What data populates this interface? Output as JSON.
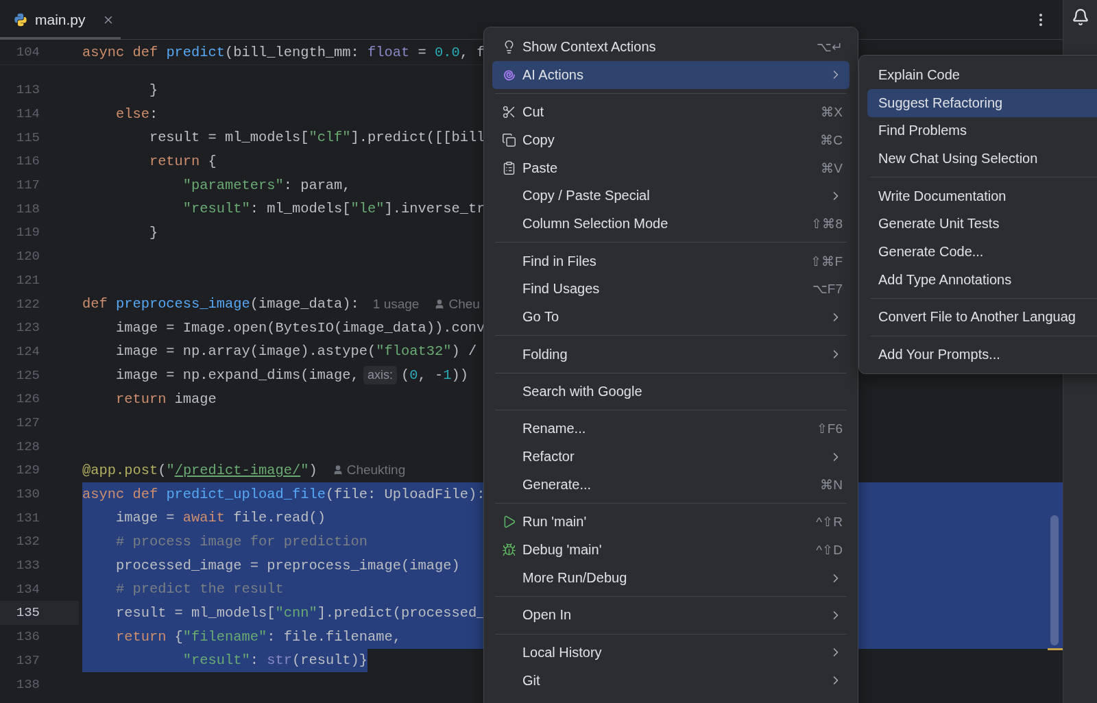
{
  "tab": {
    "label": "main.py",
    "selected": true
  },
  "sticky_line": {
    "number": "104",
    "tokens": [
      {
        "kind": "kw",
        "text": "async def "
      },
      {
        "kind": "fn",
        "text": "predict"
      },
      {
        "kind": "p",
        "text": "(bill_length_mm: "
      },
      {
        "kind": "bi",
        "text": "float"
      },
      {
        "kind": "p",
        "text": " = "
      },
      {
        "kind": "num",
        "text": "0.0"
      },
      {
        "kind": "p",
        "text": ", f"
      }
    ]
  },
  "lines": [
    {
      "number": "113",
      "current": false,
      "selected": false,
      "tokens": [
        {
          "kind": "p",
          "text": "        }"
        }
      ]
    },
    {
      "number": "114",
      "current": false,
      "selected": false,
      "tokens": [
        {
          "kind": "kw",
          "text": "    else"
        },
        {
          "kind": "p",
          "text": ":"
        }
      ]
    },
    {
      "number": "115",
      "current": false,
      "selected": false,
      "tokens": [
        {
          "kind": "p",
          "text": "        result = ml_models["
        },
        {
          "kind": "str",
          "text": "\"clf\""
        },
        {
          "kind": "p",
          "text": "].predict([[bill"
        }
      ]
    },
    {
      "number": "116",
      "current": false,
      "selected": false,
      "tokens": [
        {
          "kind": "kw",
          "text": "        return"
        },
        {
          "kind": "p",
          "text": " {"
        }
      ]
    },
    {
      "number": "117",
      "current": false,
      "selected": false,
      "tokens": [
        {
          "kind": "str",
          "text": "            \"parameters\""
        },
        {
          "kind": "p",
          "text": ": param,"
        }
      ]
    },
    {
      "number": "118",
      "current": false,
      "selected": false,
      "tokens": [
        {
          "kind": "str",
          "text": "            \"result\""
        },
        {
          "kind": "p",
          "text": ": ml_models["
        },
        {
          "kind": "str",
          "text": "\"le\""
        },
        {
          "kind": "p",
          "text": "].inverse_tr"
        }
      ]
    },
    {
      "number": "119",
      "current": false,
      "selected": false,
      "tokens": [
        {
          "kind": "p",
          "text": "        }"
        }
      ]
    },
    {
      "number": "120",
      "current": false,
      "selected": false
    },
    {
      "number": "121",
      "current": false,
      "selected": false
    },
    {
      "number": "122",
      "current": false,
      "selected": false,
      "tokens": [
        {
          "kind": "kw",
          "text": "def "
        },
        {
          "kind": "fn",
          "text": "preprocess_image"
        },
        {
          "kind": "p",
          "text": "(image_data):"
        }
      ],
      "usage_hint": "1 usage",
      "author": "Cheu"
    },
    {
      "number": "123",
      "current": false,
      "selected": false,
      "tokens": [
        {
          "kind": "p",
          "text": "    image = Image.open(BytesIO(image_data)).conv"
        }
      ]
    },
    {
      "number": "124",
      "current": false,
      "selected": false,
      "tokens": [
        {
          "kind": "p",
          "text": "    image = np.array(image).astype("
        },
        {
          "kind": "str",
          "text": "\"float32\""
        },
        {
          "kind": "p",
          "text": ") /"
        }
      ]
    },
    {
      "number": "125",
      "current": false,
      "selected": false,
      "tokens": [
        {
          "kind": "p",
          "text": "    image = np.expand_dims(image, "
        }
      ],
      "inlay": "axis:",
      "tokens_after": [
        {
          "kind": "p",
          "text": "("
        },
        {
          "kind": "num",
          "text": "0"
        },
        {
          "kind": "p",
          "text": ", -"
        },
        {
          "kind": "num",
          "text": "1"
        },
        {
          "kind": "p",
          "text": "))"
        }
      ]
    },
    {
      "number": "126",
      "current": false,
      "selected": false,
      "tokens": [
        {
          "kind": "kw",
          "text": "    return"
        },
        {
          "kind": "p",
          "text": " image"
        }
      ]
    },
    {
      "number": "127",
      "current": false,
      "selected": false
    },
    {
      "number": "128",
      "current": false,
      "selected": false
    },
    {
      "number": "129",
      "current": false,
      "selected": false,
      "tokens": [
        {
          "kind": "deco",
          "text": "@app.post"
        },
        {
          "kind": "p",
          "text": "("
        },
        {
          "kind": "str",
          "text": "\""
        },
        {
          "kind": "link",
          "text": "/predict-image/"
        },
        {
          "kind": "str",
          "text": "\""
        },
        {
          "kind": "p",
          "text": ")"
        }
      ],
      "author": "Cheukting"
    },
    {
      "number": "130",
      "current": false,
      "selected": true,
      "tokens": [
        {
          "kind": "kw",
          "text": "async def "
        },
        {
          "kind": "fn",
          "text": "predict_upload_file"
        },
        {
          "kind": "p",
          "text": "(file: UploadFile):"
        }
      ]
    },
    {
      "number": "131",
      "current": false,
      "selected": true,
      "tokens": [
        {
          "kind": "p",
          "text": "    image = "
        },
        {
          "kind": "kw",
          "text": "await"
        },
        {
          "kind": "p",
          "text": " file.read()"
        }
      ]
    },
    {
      "number": "132",
      "current": false,
      "selected": true,
      "tokens": [
        {
          "kind": "cm",
          "text": "    # process image for prediction"
        }
      ]
    },
    {
      "number": "133",
      "current": false,
      "selected": true,
      "tokens": [
        {
          "kind": "p",
          "text": "    processed_image = preprocess_image(image)"
        }
      ]
    },
    {
      "number": "134",
      "current": false,
      "selected": true,
      "tokens": [
        {
          "kind": "cm",
          "text": "    # predict the result"
        }
      ]
    },
    {
      "number": "135",
      "current": true,
      "selected": true,
      "tokens": [
        {
          "kind": "p",
          "text": "    result = ml_models["
        },
        {
          "kind": "str",
          "text": "\"cnn\""
        },
        {
          "kind": "p",
          "text": "].predict(processed_"
        }
      ]
    },
    {
      "number": "136",
      "current": false,
      "selected": true,
      "tokens": [
        {
          "kind": "kw",
          "text": "    return"
        },
        {
          "kind": "p",
          "text": " {"
        },
        {
          "kind": "str",
          "text": "\"filename\""
        },
        {
          "kind": "p",
          "text": ": file.filename,"
        }
      ]
    },
    {
      "number": "137",
      "current": false,
      "selected": true,
      "tokens": [
        {
          "kind": "str",
          "text": "            \"result\""
        },
        {
          "kind": "p",
          "text": ": "
        },
        {
          "kind": "bi",
          "text": "str"
        },
        {
          "kind": "p",
          "text": "(result)}"
        }
      ]
    },
    {
      "number": "138",
      "current": false,
      "selected": false
    }
  ],
  "context_menu": [
    [
      {
        "label": "Show Context Actions",
        "kind": "bulb",
        "shortcut": "⌥↵",
        "submenu": false,
        "selected": false
      },
      {
        "label": "AI Actions",
        "kind": "spiral",
        "submenu": true,
        "selected": true
      }
    ],
    [
      {
        "label": "Cut",
        "kind": "scissors",
        "shortcut": "⌘X",
        "submenu": false,
        "selected": false
      },
      {
        "label": "Copy",
        "kind": "copy",
        "shortcut": "⌘C",
        "submenu": false,
        "selected": false
      },
      {
        "label": "Paste",
        "kind": "paste",
        "shortcut": "⌘V",
        "submenu": false,
        "selected": false
      },
      {
        "label": "Copy / Paste Special",
        "submenu": true,
        "selected": false
      },
      {
        "label": "Column Selection Mode",
        "shortcut": "⇧⌘8",
        "submenu": false,
        "selected": false
      }
    ],
    [
      {
        "label": "Find in Files",
        "shortcut": "⇧⌘F",
        "submenu": false,
        "selected": false
      },
      {
        "label": "Find Usages",
        "shortcut": "⌥F7",
        "submenu": false,
        "selected": false
      },
      {
        "label": "Go To",
        "submenu": true,
        "selected": false
      }
    ],
    [
      {
        "label": "Folding",
        "submenu": true,
        "selected": false
      }
    ],
    [
      {
        "label": "Search with Google",
        "submenu": false,
        "selected": false
      }
    ],
    [
      {
        "label": "Rename...",
        "shortcut": "⇧F6",
        "submenu": false,
        "selected": false
      },
      {
        "label": "Refactor",
        "submenu": true,
        "selected": false
      },
      {
        "label": "Generate...",
        "shortcut": "⌘N",
        "submenu": false,
        "selected": false
      }
    ],
    [
      {
        "label": "Run 'main'",
        "kind": "play",
        "shortcut": "^⇧R",
        "submenu": false,
        "selected": false
      },
      {
        "label": "Debug 'main'",
        "kind": "bug",
        "shortcut": "^⇧D",
        "submenu": false,
        "selected": false
      },
      {
        "label": "More Run/Debug",
        "submenu": true,
        "selected": false
      }
    ],
    [
      {
        "label": "Open In",
        "submenu": true,
        "selected": false
      }
    ],
    [
      {
        "label": "Local History",
        "submenu": true,
        "selected": false
      },
      {
        "label": "Git",
        "submenu": true,
        "selected": false
      }
    ]
  ],
  "ai_submenu": [
    [
      {
        "label": "Explain Code",
        "selected": false
      },
      {
        "label": "Suggest Refactoring",
        "selected": true
      },
      {
        "label": "Find Problems",
        "selected": false
      },
      {
        "label": "New Chat Using Selection",
        "selected": false
      }
    ],
    [
      {
        "label": "Write Documentation",
        "selected": false
      },
      {
        "label": "Generate Unit Tests",
        "selected": false
      },
      {
        "label": "Generate Code...",
        "selected": false
      },
      {
        "label": "Add Type Annotations",
        "selected": false
      }
    ],
    [
      {
        "label": "Convert File to Another Languag",
        "selected": false
      }
    ],
    [
      {
        "label": "Add Your Prompts...",
        "selected": false
      }
    ]
  ]
}
